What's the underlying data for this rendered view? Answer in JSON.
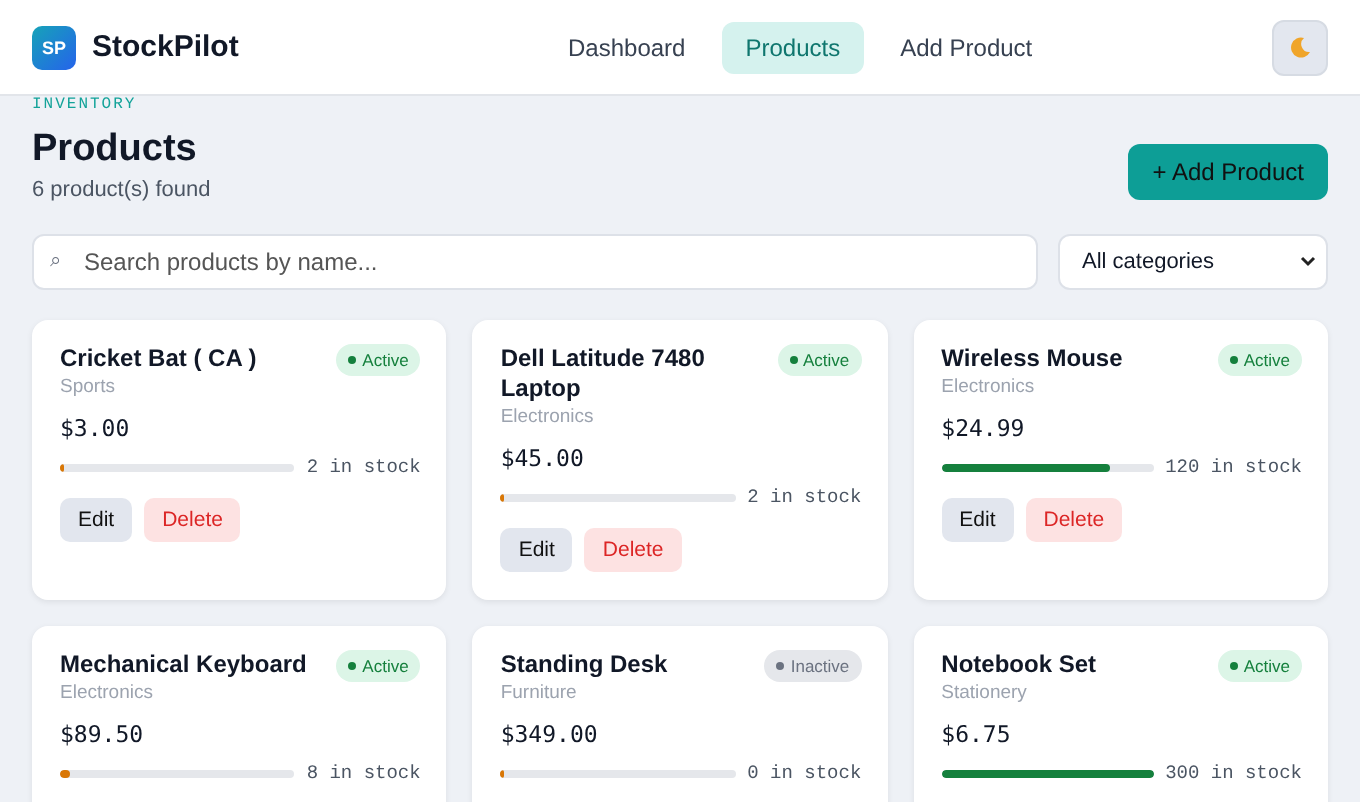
{
  "app": {
    "logo": "SP",
    "name": "StockPilot"
  },
  "nav": [
    {
      "label": "Dashboard",
      "selected": false
    },
    {
      "label": "Products",
      "selected": true
    },
    {
      "label": "Add Product",
      "selected": false
    }
  ],
  "page": {
    "eyebrow": "INVENTORY",
    "title": "Products",
    "count": "6 product(s) found",
    "add_button": "+ Add Product"
  },
  "search": {
    "icon": "⌕",
    "placeholder": "Search products by name..."
  },
  "category_filter": {
    "value": "All categories"
  },
  "products": [
    {
      "name": "Cricket Bat ( CA )",
      "status": "Active",
      "active": true,
      "category": "Sports",
      "price": "$3.00",
      "level": 0.01,
      "stock": "2 in stock",
      "edit": "Edit",
      "delete": "Delete"
    },
    {
      "name": "Dell Latitude 7480 Laptop",
      "status": "Active",
      "active": true,
      "category": "Electronics",
      "price": "$45.00",
      "level": 0.01,
      "stock": "2 in stock",
      "edit": "Edit",
      "delete": "Delete"
    },
    {
      "name": "Wireless Mouse",
      "status": "Active",
      "active": true,
      "category": "Electronics",
      "price": "$24.99",
      "level": 0.8,
      "stock": "120 in stock",
      "edit": "Edit",
      "delete": "Delete"
    },
    {
      "name": "Mechanical Keyboard",
      "status": "Active",
      "active": true,
      "category": "Electronics",
      "price": "$89.50",
      "level": 0.04,
      "stock": "8 in stock"
    },
    {
      "name": "Standing Desk",
      "status": "Inactive",
      "active": false,
      "category": "Furniture",
      "price": "$349.00",
      "level": 0,
      "stock": "0 in stock"
    },
    {
      "name": "Notebook Set",
      "status": "Active",
      "active": true,
      "category": "Stationery",
      "price": "$6.75",
      "level": 1,
      "stock": "300 in stock"
    }
  ]
}
